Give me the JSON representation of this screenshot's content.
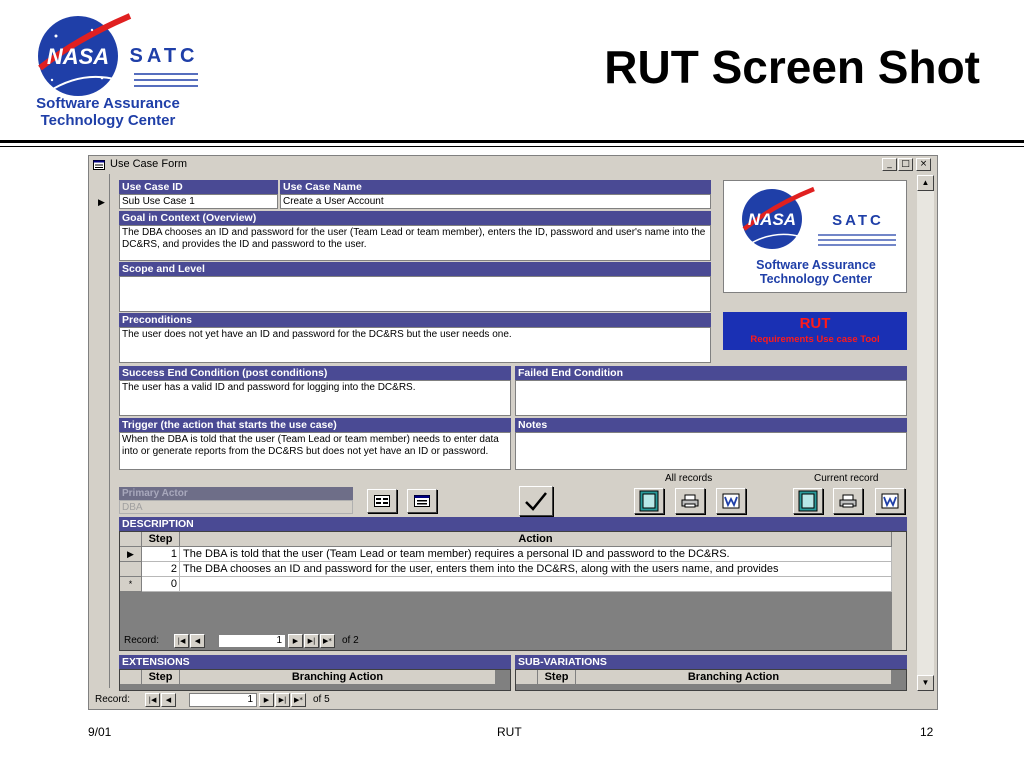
{
  "slide": {
    "title": "RUT Screen Shot",
    "logo": {
      "org": "NASA",
      "acronym": "SATC",
      "line1": "Software Assurance",
      "line2": "Technology Center"
    },
    "footer": {
      "date": "9/01",
      "center": "RUT",
      "page": "12"
    }
  },
  "window": {
    "title": "Use Case Form",
    "controls": {
      "minimize": "_",
      "maximize": "□",
      "close": "×"
    }
  },
  "form": {
    "use_case_id": {
      "label": "Use Case ID",
      "value": "Sub Use Case 1"
    },
    "use_case_name": {
      "label": "Use Case Name",
      "value": "Create a User Account"
    },
    "goal": {
      "label": "Goal in Context (Overview)",
      "value": "The DBA chooses an ID and password for the user (Team Lead or team member), enters the ID, password and user's name into the DC&RS, and provides the ID and password to the user."
    },
    "scope": {
      "label": "Scope and Level",
      "value": ""
    },
    "preconditions": {
      "label": "Preconditions",
      "value": "The user does not yet have an ID and password for the DC&RS but the user needs one."
    },
    "success": {
      "label": "Success End Condition (post conditions)",
      "value": "The user has a valid ID and password for logging into the DC&RS."
    },
    "failed": {
      "label": "Failed End Condition",
      "value": ""
    },
    "trigger": {
      "label": "Trigger (the action that starts the use case)",
      "value": "When the DBA is told that the user (Team Lead or team member) needs to enter data into or generate reports from the DC&RS but does not yet have an ID or password."
    },
    "notes": {
      "label": "Notes",
      "value": ""
    },
    "primary_actor": {
      "label": "Primary Actor",
      "value": "DBA"
    }
  },
  "rut_banner": {
    "title": "RUT",
    "subtitle": "Requirements Use case Tool"
  },
  "toolbar": {
    "all_records_label": "All records",
    "current_record_label": "Current record"
  },
  "description": {
    "label": "DESCRIPTION",
    "columns": [
      "Step",
      "Action"
    ],
    "rows": [
      {
        "step": "1",
        "action": "The DBA is told that the user (Team Lead or team member) requires a personal ID and password to the DC&RS."
      },
      {
        "step": "2",
        "action": "The DBA chooses an ID and password for the user, enters them into the DC&RS, along with the users name, and provides"
      }
    ],
    "new_row": {
      "marker": "*",
      "step": "0"
    },
    "nav": {
      "label": "Record:",
      "current": "1",
      "of": "of  2"
    }
  },
  "extensions": {
    "label": "EXTENSIONS",
    "columns": [
      "Step",
      "Branching Action"
    ]
  },
  "subvariations": {
    "label": "SUB-VARIATIONS",
    "columns": [
      "Step",
      "Branching Action"
    ]
  },
  "main_nav": {
    "label": "Record:",
    "current": "1",
    "of": "of  5"
  }
}
